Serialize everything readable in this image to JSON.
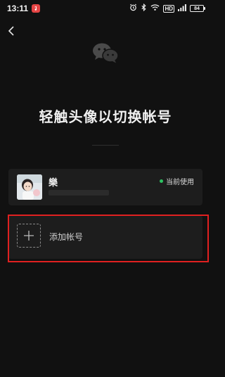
{
  "status_bar": {
    "time": "13:11",
    "network_badge": "HD",
    "battery_level": "84"
  },
  "icons": {
    "back": "chevron-left-icon",
    "logo": "wechat-logo-icon",
    "add": "plus-icon"
  },
  "header": {
    "title": "轻触头像以切换帐号"
  },
  "accounts": [
    {
      "name": "樂",
      "status": "当前使用"
    }
  ],
  "add_account": {
    "label": "添加帐号"
  },
  "colors": {
    "background": "#111111",
    "card": "#1d1d1d",
    "active_dot": "#2ec162",
    "highlight": "#e02020"
  }
}
